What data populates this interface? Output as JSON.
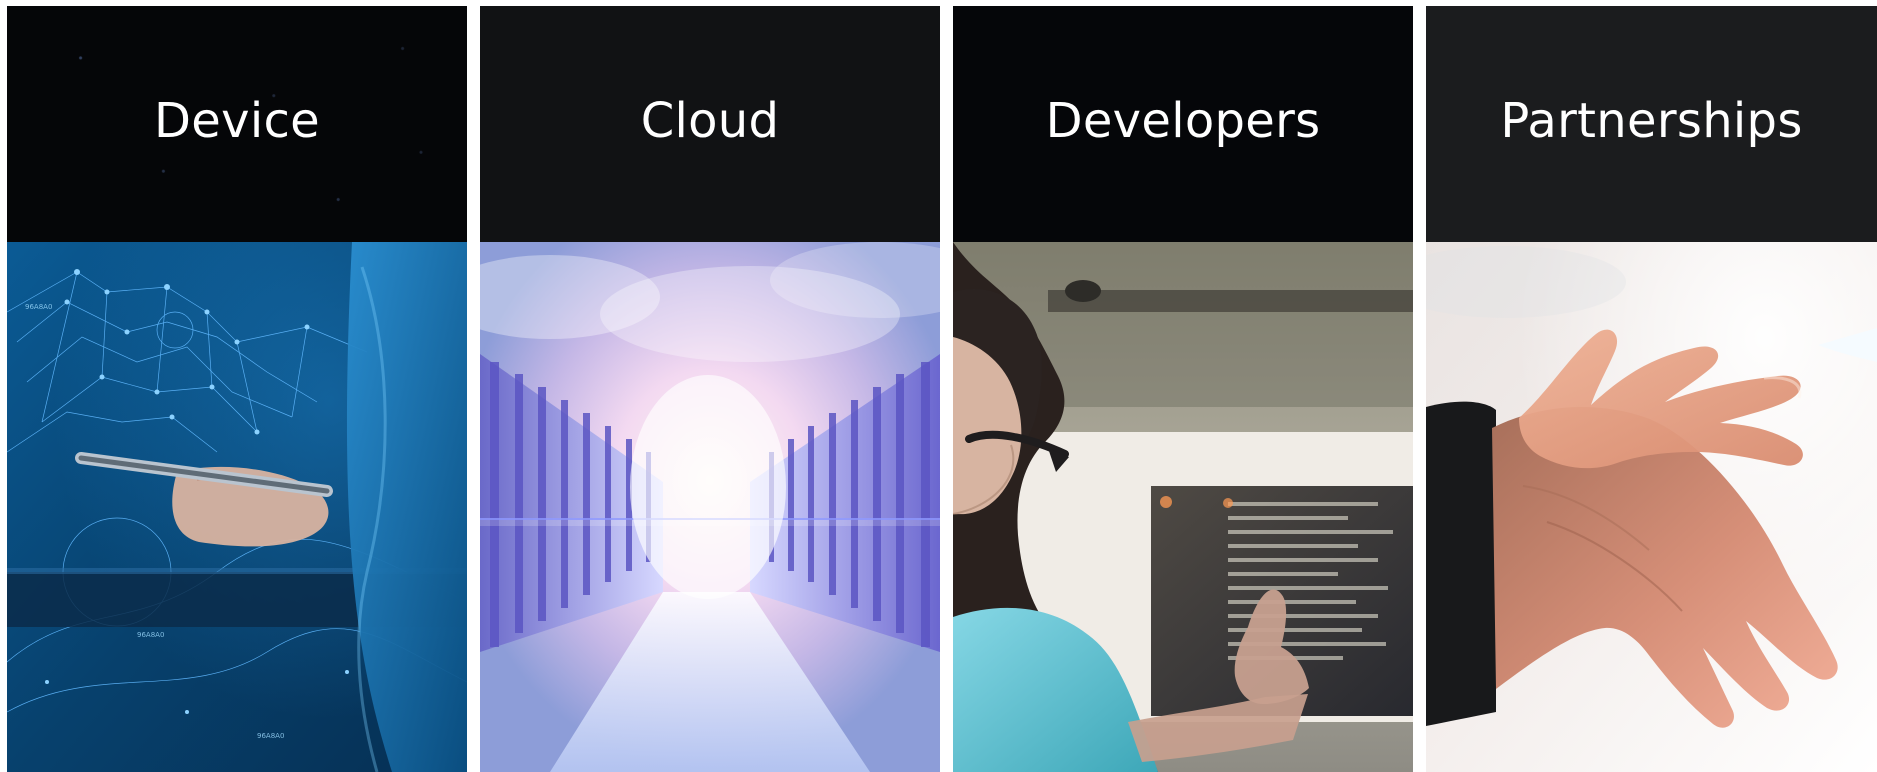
{
  "cards": [
    {
      "title": "Device",
      "image": "device-hand-holding-stylus-photo"
    },
    {
      "title": "Cloud",
      "image": "cloud-server-corridor-photo"
    },
    {
      "title": "Developers",
      "image": "developer-pointing-at-monitor-photo"
    },
    {
      "title": "Partnerships",
      "image": "handshake-photo"
    }
  ],
  "colors": {
    "header_background": "#050608",
    "header_text": "#ffffff",
    "device_blue": "#0a4f82",
    "cloud_violet": "#6a5cc7",
    "developers_cyan": "#67c1cc",
    "partnerships_skin": "#e19a7a"
  }
}
